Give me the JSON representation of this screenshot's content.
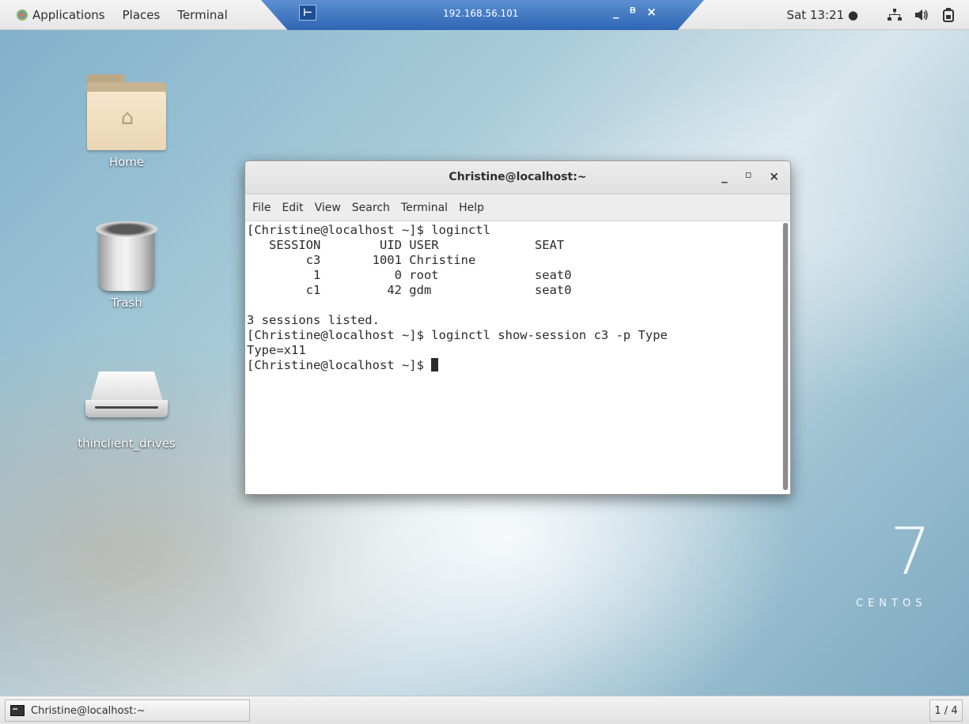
{
  "top_panel": {
    "menu": [
      "Applications",
      "Places",
      "Terminal"
    ],
    "remote_host": "192.168.56.101",
    "remote_controls": [
      "_",
      "ᵉ",
      "×"
    ],
    "clock": "Sat 13:21 ●",
    "tray_icons": [
      "network-icon",
      "volume-icon",
      "power-icon"
    ]
  },
  "desktop_icons": {
    "home": "Home",
    "trash": "Trash",
    "drive": "thinclient_drives"
  },
  "terminal": {
    "title": "Christine@localhost:~",
    "menu": [
      "File",
      "Edit",
      "View",
      "Search",
      "Terminal",
      "Help"
    ],
    "lines": [
      "[Christine@localhost ~]$ loginctl",
      "   SESSION        UID USER             SEAT",
      "        c3       1001 Christine",
      "         1          0 root             seat0",
      "        c1         42 gdm              seat0",
      "",
      "3 sessions listed.",
      "[Christine@localhost ~]$ loginctl show-session c3 -p Type",
      "Type=x11"
    ],
    "prompt": "[Christine@localhost ~]$ "
  },
  "watermark": {
    "number": "7",
    "word": "CENTOS"
  },
  "bottom_panel": {
    "task_label": "Christine@localhost:~",
    "workspace": "1 / 4"
  }
}
